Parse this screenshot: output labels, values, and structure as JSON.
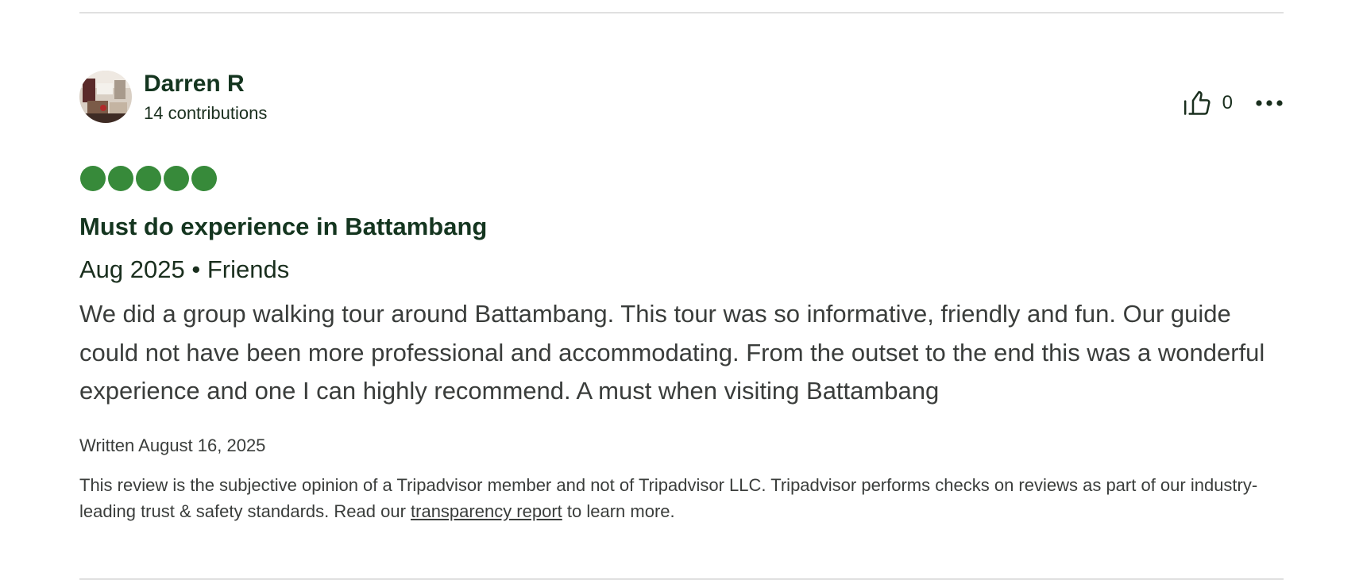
{
  "review": {
    "author": {
      "name": "Darren R",
      "contributions": "14 contributions"
    },
    "helpful_count": "0",
    "rating": 5,
    "rating_max": 5,
    "title": "Must do experience in Battambang",
    "visit_date": "Aug 2025",
    "separator": " • ",
    "trip_type": "Friends",
    "body": "We did a group walking tour around Battambang. This tour was so informative, friendly and fun. Our guide could not have been more professional and accommodating. From the outset to the end this was a wonderful experience and one I can highly recommend. A must when visiting Battambang",
    "written": "Written August 16, 2025",
    "disclaimer": {
      "prefix": "This review is the subjective opinion of a Tripadvisor member and not of Tripadvisor LLC. Tripadvisor performs checks on reviews as part of our industry-leading trust & safety standards. Read our ",
      "link_text": "transparency report",
      "suffix": " to learn more."
    }
  },
  "colors": {
    "bubble_fill": "#378a3a",
    "heading": "#14351f",
    "body_text": "#3a3d3b",
    "divider": "#e0e0e0"
  },
  "icons": {
    "like": "thumbs-up-icon",
    "more": "more-options-icon"
  }
}
